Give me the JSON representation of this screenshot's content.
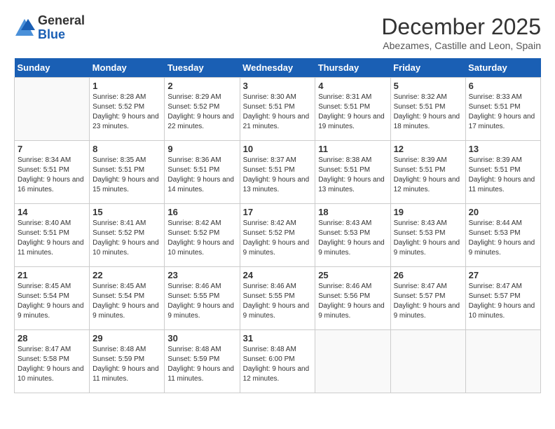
{
  "header": {
    "logo_general": "General",
    "logo_blue": "Blue",
    "month_title": "December 2025",
    "location": "Abezames, Castille and Leon, Spain"
  },
  "weekdays": [
    "Sunday",
    "Monday",
    "Tuesday",
    "Wednesday",
    "Thursday",
    "Friday",
    "Saturday"
  ],
  "weeks": [
    [
      {
        "day": "",
        "sunrise": "",
        "sunset": "",
        "daylight": "",
        "empty": true
      },
      {
        "day": "1",
        "sunrise": "Sunrise: 8:28 AM",
        "sunset": "Sunset: 5:52 PM",
        "daylight": "Daylight: 9 hours and 23 minutes."
      },
      {
        "day": "2",
        "sunrise": "Sunrise: 8:29 AM",
        "sunset": "Sunset: 5:52 PM",
        "daylight": "Daylight: 9 hours and 22 minutes."
      },
      {
        "day": "3",
        "sunrise": "Sunrise: 8:30 AM",
        "sunset": "Sunset: 5:51 PM",
        "daylight": "Daylight: 9 hours and 21 minutes."
      },
      {
        "day": "4",
        "sunrise": "Sunrise: 8:31 AM",
        "sunset": "Sunset: 5:51 PM",
        "daylight": "Daylight: 9 hours and 19 minutes."
      },
      {
        "day": "5",
        "sunrise": "Sunrise: 8:32 AM",
        "sunset": "Sunset: 5:51 PM",
        "daylight": "Daylight: 9 hours and 18 minutes."
      },
      {
        "day": "6",
        "sunrise": "Sunrise: 8:33 AM",
        "sunset": "Sunset: 5:51 PM",
        "daylight": "Daylight: 9 hours and 17 minutes."
      }
    ],
    [
      {
        "day": "7",
        "sunrise": "Sunrise: 8:34 AM",
        "sunset": "Sunset: 5:51 PM",
        "daylight": "Daylight: 9 hours and 16 minutes."
      },
      {
        "day": "8",
        "sunrise": "Sunrise: 8:35 AM",
        "sunset": "Sunset: 5:51 PM",
        "daylight": "Daylight: 9 hours and 15 minutes."
      },
      {
        "day": "9",
        "sunrise": "Sunrise: 8:36 AM",
        "sunset": "Sunset: 5:51 PM",
        "daylight": "Daylight: 9 hours and 14 minutes."
      },
      {
        "day": "10",
        "sunrise": "Sunrise: 8:37 AM",
        "sunset": "Sunset: 5:51 PM",
        "daylight": "Daylight: 9 hours and 13 minutes."
      },
      {
        "day": "11",
        "sunrise": "Sunrise: 8:38 AM",
        "sunset": "Sunset: 5:51 PM",
        "daylight": "Daylight: 9 hours and 13 minutes."
      },
      {
        "day": "12",
        "sunrise": "Sunrise: 8:39 AM",
        "sunset": "Sunset: 5:51 PM",
        "daylight": "Daylight: 9 hours and 12 minutes."
      },
      {
        "day": "13",
        "sunrise": "Sunrise: 8:39 AM",
        "sunset": "Sunset: 5:51 PM",
        "daylight": "Daylight: 9 hours and 11 minutes."
      }
    ],
    [
      {
        "day": "14",
        "sunrise": "Sunrise: 8:40 AM",
        "sunset": "Sunset: 5:51 PM",
        "daylight": "Daylight: 9 hours and 11 minutes."
      },
      {
        "day": "15",
        "sunrise": "Sunrise: 8:41 AM",
        "sunset": "Sunset: 5:52 PM",
        "daylight": "Daylight: 9 hours and 10 minutes."
      },
      {
        "day": "16",
        "sunrise": "Sunrise: 8:42 AM",
        "sunset": "Sunset: 5:52 PM",
        "daylight": "Daylight: 9 hours and 10 minutes."
      },
      {
        "day": "17",
        "sunrise": "Sunrise: 8:42 AM",
        "sunset": "Sunset: 5:52 PM",
        "daylight": "Daylight: 9 hours and 9 minutes."
      },
      {
        "day": "18",
        "sunrise": "Sunrise: 8:43 AM",
        "sunset": "Sunset: 5:53 PM",
        "daylight": "Daylight: 9 hours and 9 minutes."
      },
      {
        "day": "19",
        "sunrise": "Sunrise: 8:43 AM",
        "sunset": "Sunset: 5:53 PM",
        "daylight": "Daylight: 9 hours and 9 minutes."
      },
      {
        "day": "20",
        "sunrise": "Sunrise: 8:44 AM",
        "sunset": "Sunset: 5:53 PM",
        "daylight": "Daylight: 9 hours and 9 minutes."
      }
    ],
    [
      {
        "day": "21",
        "sunrise": "Sunrise: 8:45 AM",
        "sunset": "Sunset: 5:54 PM",
        "daylight": "Daylight: 9 hours and 9 minutes."
      },
      {
        "day": "22",
        "sunrise": "Sunrise: 8:45 AM",
        "sunset": "Sunset: 5:54 PM",
        "daylight": "Daylight: 9 hours and 9 minutes."
      },
      {
        "day": "23",
        "sunrise": "Sunrise: 8:46 AM",
        "sunset": "Sunset: 5:55 PM",
        "daylight": "Daylight: 9 hours and 9 minutes."
      },
      {
        "day": "24",
        "sunrise": "Sunrise: 8:46 AM",
        "sunset": "Sunset: 5:55 PM",
        "daylight": "Daylight: 9 hours and 9 minutes."
      },
      {
        "day": "25",
        "sunrise": "Sunrise: 8:46 AM",
        "sunset": "Sunset: 5:56 PM",
        "daylight": "Daylight: 9 hours and 9 minutes."
      },
      {
        "day": "26",
        "sunrise": "Sunrise: 8:47 AM",
        "sunset": "Sunset: 5:57 PM",
        "daylight": "Daylight: 9 hours and 9 minutes."
      },
      {
        "day": "27",
        "sunrise": "Sunrise: 8:47 AM",
        "sunset": "Sunset: 5:57 PM",
        "daylight": "Daylight: 9 hours and 10 minutes."
      }
    ],
    [
      {
        "day": "28",
        "sunrise": "Sunrise: 8:47 AM",
        "sunset": "Sunset: 5:58 PM",
        "daylight": "Daylight: 9 hours and 10 minutes."
      },
      {
        "day": "29",
        "sunrise": "Sunrise: 8:48 AM",
        "sunset": "Sunset: 5:59 PM",
        "daylight": "Daylight: 9 hours and 11 minutes."
      },
      {
        "day": "30",
        "sunrise": "Sunrise: 8:48 AM",
        "sunset": "Sunset: 5:59 PM",
        "daylight": "Daylight: 9 hours and 11 minutes."
      },
      {
        "day": "31",
        "sunrise": "Sunrise: 8:48 AM",
        "sunset": "Sunset: 6:00 PM",
        "daylight": "Daylight: 9 hours and 12 minutes."
      },
      {
        "day": "",
        "sunrise": "",
        "sunset": "",
        "daylight": "",
        "empty": true
      },
      {
        "day": "",
        "sunrise": "",
        "sunset": "",
        "daylight": "",
        "empty": true
      },
      {
        "day": "",
        "sunrise": "",
        "sunset": "",
        "daylight": "",
        "empty": true
      }
    ]
  ]
}
